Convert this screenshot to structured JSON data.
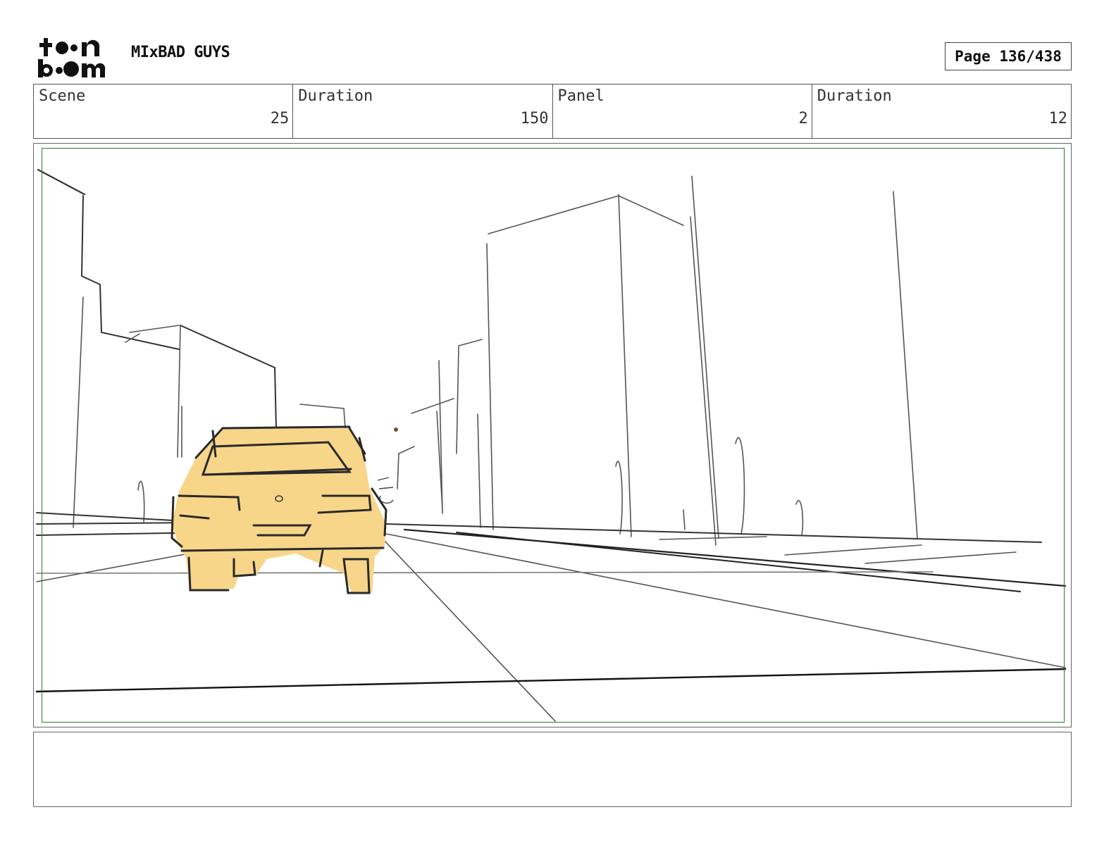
{
  "header": {
    "logo_text": "toon boom",
    "project_title": "MIxBAD GUYS",
    "page_label": "Page 136/438"
  },
  "info": [
    {
      "label": "Scene",
      "value": "25"
    },
    {
      "label": "Duration",
      "value": "150"
    },
    {
      "label": "Panel",
      "value": "2"
    },
    {
      "label": "Duration",
      "value": "12"
    }
  ],
  "panel": {
    "description": "",
    "car_color": "#f7d68a",
    "safe_frame_color": "#2f7a2f"
  },
  "notes": {
    "text": ""
  }
}
